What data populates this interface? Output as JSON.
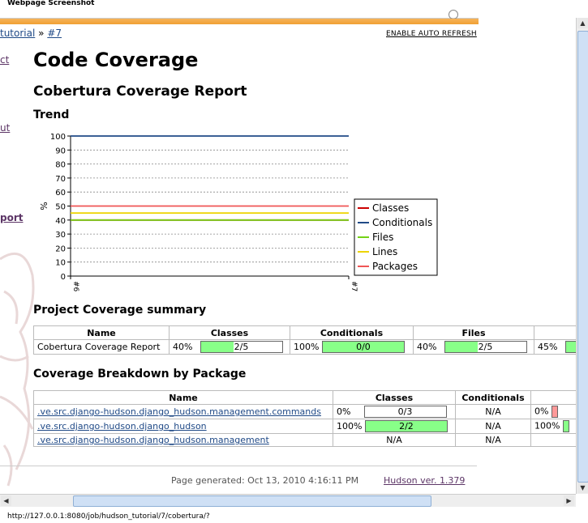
{
  "window": {
    "title": "Webpage Screenshot"
  },
  "nav": {
    "breadcrumb_job": "tutorial",
    "breadcrumb_sep": "»",
    "breadcrumb_build": "#7",
    "auto_refresh": "ENABLE AUTO REFRESH"
  },
  "sidebar": {
    "items": [
      "ct",
      "ut",
      "port"
    ]
  },
  "page": {
    "title": "Code Coverage",
    "report_title": "Cobertura Coverage Report",
    "trend_heading": "Trend",
    "summary_heading": "Project Coverage summary",
    "breakdown_heading": "Coverage Breakdown by Package"
  },
  "chart_data": {
    "type": "line",
    "x": [
      "#6",
      "#7"
    ],
    "ylabel": "%",
    "ylim": [
      0,
      100
    ],
    "yticks": [
      0,
      10,
      20,
      30,
      40,
      50,
      60,
      70,
      80,
      90,
      100
    ],
    "grid": true,
    "legend_position": "right",
    "series": [
      {
        "name": "Classes",
        "color": "#cc0000",
        "values": [
          40,
          40
        ]
      },
      {
        "name": "Conditionals",
        "color": "#204a87",
        "values": [
          100,
          100
        ]
      },
      {
        "name": "Files",
        "color": "#73d216",
        "values": [
          40,
          40
        ]
      },
      {
        "name": "Lines",
        "color": "#edd400",
        "values": [
          45,
          45
        ]
      },
      {
        "name": "Packages",
        "color": "#ef5555",
        "values": [
          50,
          50
        ]
      }
    ]
  },
  "summary": {
    "headers": [
      "Name",
      "Classes",
      "Conditionals",
      "Files",
      ""
    ],
    "row": {
      "name": "Cobertura Coverage Report",
      "classes_pct": "40%",
      "classes_ratio": "2/5",
      "classes_fill": 0.4,
      "cond_pct": "100%",
      "cond_ratio": "0/0",
      "cond_fill": 1.0,
      "files_pct": "40%",
      "files_ratio": "2/5",
      "files_fill": 0.4,
      "lines_pct": "45%"
    }
  },
  "breakdown": {
    "headers": [
      "Name",
      "Classes",
      "Conditionals",
      ""
    ],
    "rows": [
      {
        "name": ".ve.src.django-hudson.django_hudson.management.commands",
        "classes_pct": "0%",
        "classes_ratio": "0/3",
        "classes_fill": 0.0,
        "cond": "N/A",
        "next_pct": "0%"
      },
      {
        "name": ".ve.src.django-hudson.django_hudson",
        "classes_pct": "100%",
        "classes_ratio": "2/2",
        "classes_fill": 1.0,
        "cond": "N/A",
        "next_pct": "100%"
      },
      {
        "name": ".ve.src.django-hudson.django_hudson.management",
        "classes_na": "N/A",
        "cond": "N/A",
        "next_pct": ""
      }
    ]
  },
  "footer": {
    "generated": "Page generated: Oct 13, 2010 4:16:11 PM",
    "version": "Hudson ver. 1.379"
  },
  "statusbar": {
    "url": "http://127.0.0.1:8080/job/hudson_tutorial/7/cobertura/?"
  },
  "colors": {
    "accent": "#f0a033",
    "bar_good": "#88ff88",
    "bar_bad": "#ff9999",
    "link": "#204a87"
  }
}
